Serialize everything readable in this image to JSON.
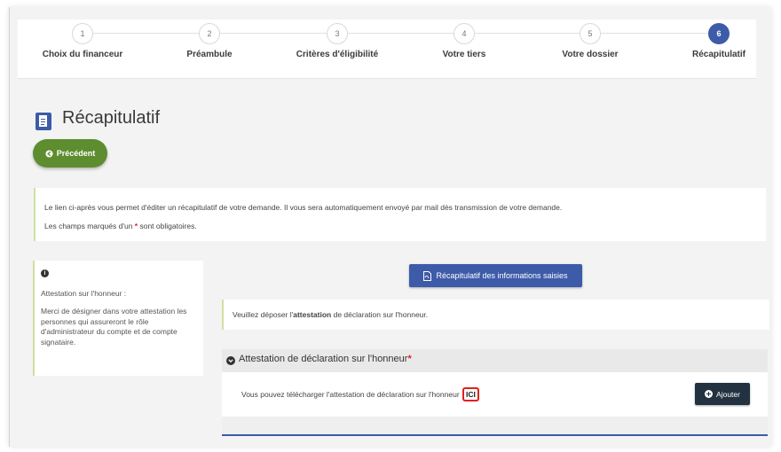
{
  "stepper": {
    "steps": [
      {
        "number": "1",
        "label": "Choix du financeur"
      },
      {
        "number": "2",
        "label": "Préambule"
      },
      {
        "number": "3",
        "label": "Critères d'éligibilité"
      },
      {
        "number": "4",
        "label": "Votre tiers"
      },
      {
        "number": "5",
        "label": "Votre dossier"
      },
      {
        "number": "6",
        "label": "Récapitulatif"
      }
    ],
    "active_step": 6,
    "active_color": "#3d5ba8"
  },
  "page": {
    "title": "Récapitulatif",
    "title_icon": "document-icon",
    "prev_button": "Précédent",
    "prev_icon": "arrow-left-circle-icon",
    "prev_color": "#5d8d2e"
  },
  "info": {
    "line1": "Le lien ci-après vous permet d'éditer un récapitulatif de votre demande. Il vous sera automatiquement envoyé par mail dès transmission de votre demande.",
    "line2_before": "Les champs marqués d'un ",
    "line2_star": "*",
    "line2_after": " sont obligatoires."
  },
  "side_help": {
    "icon": "info-icon",
    "title": "Attestation sur l'honneur :",
    "text": "Merci de désigner dans votre attestation les personnes qui assureront le rôle d'administrateur du compte et de compte signataire."
  },
  "recap_button": {
    "label": "Récapitulatif des informations saisies",
    "icon": "pdf-file-icon"
  },
  "notice": {
    "before": "Veuillez déposer l'",
    "bold": "attestation",
    "after": " de déclaration sur l'honneur."
  },
  "attestation_panel": {
    "title": "Attestation de déclaration sur l'honneur",
    "required_star": "*",
    "text": "Vous pouvez télécharger l'attestation de déclaration sur l'honneur",
    "link": "ICI",
    "add_button": "Ajouter",
    "highlight_color": "#e0221d"
  }
}
